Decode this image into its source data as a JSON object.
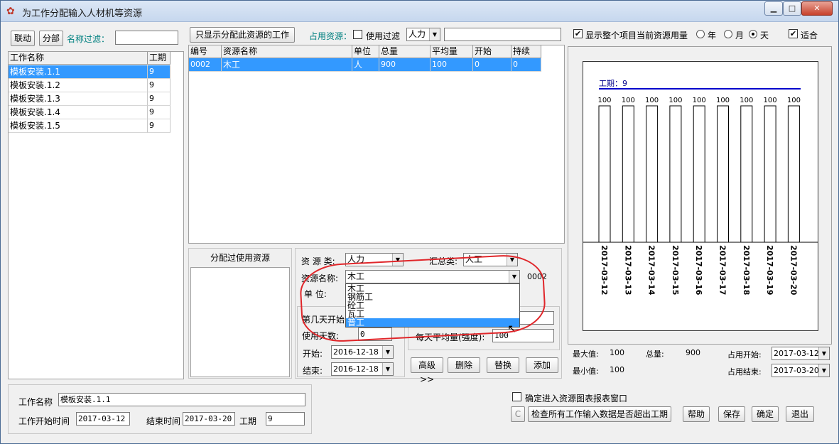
{
  "window": {
    "title": "为工作分配输入人材机等资源",
    "app_icon": "app-logo-icon",
    "controls": {
      "minimize": "▁",
      "maximize": "□",
      "close": "✕"
    }
  },
  "left": {
    "link_button": "联动",
    "split_button": "分部",
    "name_filter_label": "名称过滤：",
    "name_filter_value": "",
    "columns": [
      "工作名称",
      "工期"
    ],
    "rows": [
      {
        "name": "模板安装.1.1",
        "duration": "9",
        "selected": true
      },
      {
        "name": "模板安装.1.2",
        "duration": "9"
      },
      {
        "name": "模板安装.1.3",
        "duration": "9"
      },
      {
        "name": "模板安装.1.4",
        "duration": "9"
      },
      {
        "name": "模板安装.1.5",
        "duration": "9"
      }
    ]
  },
  "middle": {
    "only_show_button": "只显示分配此资源的工作",
    "occupied_label": "占用资源：",
    "use_filter_label": "使用过滤",
    "resource_type_value": "人力",
    "filter_text": "",
    "columns": [
      "编号",
      "资源名称",
      "单位",
      "总量",
      "平均量",
      "开始",
      "持续"
    ],
    "rows": [
      {
        "id": "0002",
        "name": "木工",
        "unit": "人",
        "total": "900",
        "avg": "100",
        "start": "0",
        "duration": "0"
      }
    ],
    "assigned_title": "分配过使用资源"
  },
  "form": {
    "resource_type_label": "资 源 类:",
    "resource_type_value": "人力",
    "summary_type_label": "汇总类:",
    "summary_type_value": "人工",
    "resource_name_label": "资源名称:",
    "resource_name_value": "木工",
    "resource_code": "0002",
    "unit_label": "单    位:",
    "dropdown_options": [
      "木工",
      "钢筋工",
      "砼工",
      "瓦工",
      "普工"
    ],
    "dropdown_selected_index": 4,
    "start_day_label": "第几天开始",
    "start_day_value": "",
    "use_days_label": "使用天数:",
    "use_days_value": "0",
    "daily_avg_label": "每天平均量(强度):",
    "daily_avg_value": "100",
    "start_label": "开始:",
    "start_value": "2016-12-18",
    "end_label": "结束:",
    "end_value": "2016-12-18",
    "buttons": {
      "advanced": "高级>>",
      "delete": "删除",
      "replace": "替换",
      "add": "添加"
    }
  },
  "chart_panel": {
    "show_all_label": "显示整个项目当前资源用量",
    "year_label": "年",
    "month_label": "月",
    "day_label": "天",
    "fit_label": "适合",
    "max_label": "最大值:",
    "max_value": "100",
    "total_label": "总量:",
    "total_value": "900",
    "min_label": "最小值:",
    "min_value": "100",
    "occupy_start_label": "占用开始:",
    "occupy_start_value": "2017-03-12",
    "occupy_end_label": "占用结束:",
    "occupy_end_value": "2017-03-20"
  },
  "chart_data": {
    "type": "bar",
    "annotation": "工期：9",
    "categories": [
      "2017-03-12",
      "2017-03-13",
      "2017-03-14",
      "2017-03-15",
      "2017-03-16",
      "2017-03-17",
      "2017-03-18",
      "2017-03-19",
      "2017-03-20"
    ],
    "values": [
      100,
      100,
      100,
      100,
      100,
      100,
      100,
      100,
      100
    ],
    "ylim": [
      0,
      100
    ],
    "grid": false
  },
  "bottom": {
    "work_name_label": "工作名称",
    "work_name_value": "模板安装.1.1",
    "start_time_label": "工作开始时间",
    "start_time_value": "2017-03-12",
    "end_time_label": "结束时间",
    "end_time_value": "2017-03-20",
    "duration_label": "工期",
    "duration_value": "9",
    "enter_chart_label": "确定进入资源图表报表窗口",
    "c_button": "C",
    "check_button": "检查所有工作输入数据是否超出工期",
    "help_button": "帮助",
    "save_button": "保存",
    "ok_button": "确定",
    "exit_button": "退出"
  }
}
